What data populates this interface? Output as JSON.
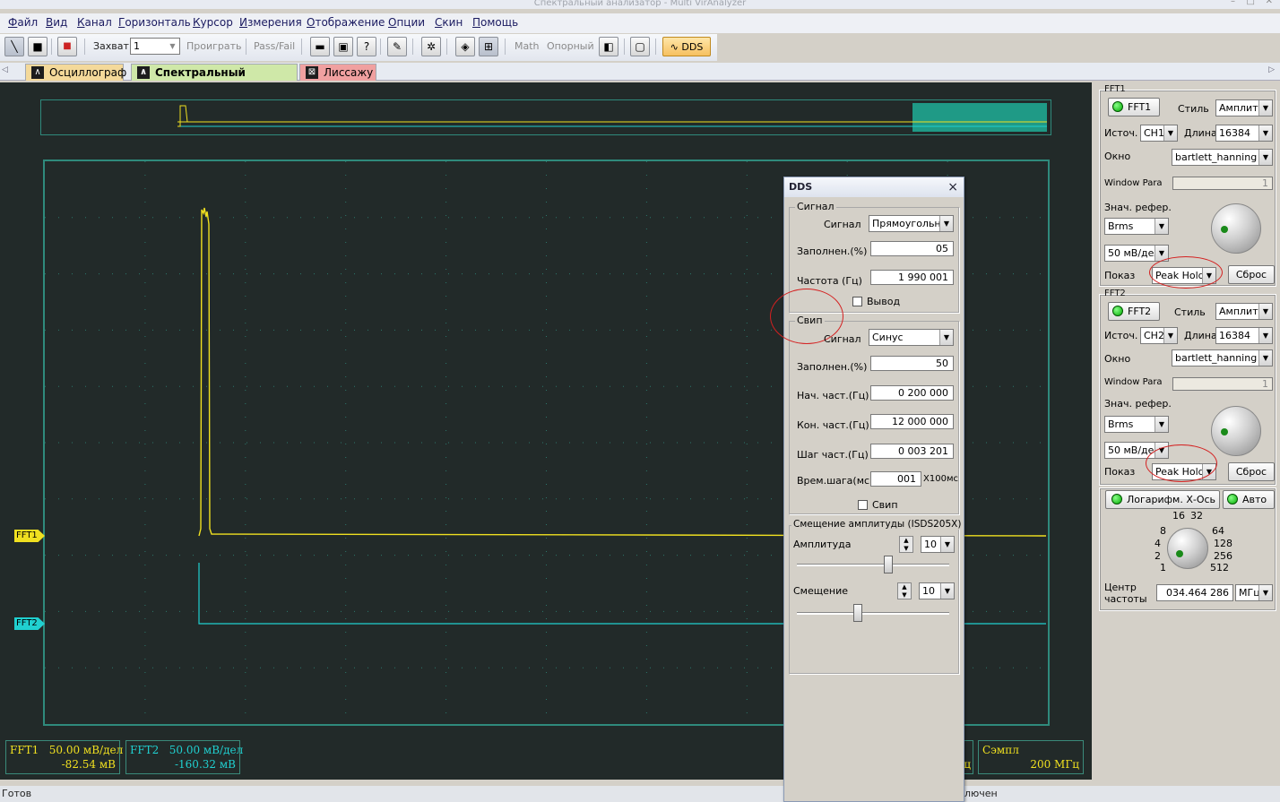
{
  "window": {
    "title": "Спектральный анализатор - Multi VirAnalyzer"
  },
  "menu": [
    "Файл",
    "Вид",
    "Канал",
    "Горизонталь",
    "Курсор",
    "Измерения",
    "Отображение",
    "Опции",
    "Скин",
    "Помощь"
  ],
  "toolbar": {
    "capture_label": "Захват",
    "capture_value": "1",
    "play_label": "Проиграть",
    "passfail_label": "Pass/Fail",
    "math_label": "Math",
    "ref_label": "Опорный",
    "dds_label": "DDS"
  },
  "tabs": [
    {
      "label": "Осциллограф",
      "color": "#f4d99a"
    },
    {
      "label": "Спектральный анализатор",
      "color": "#cfe8a8"
    },
    {
      "label": "Лиссажу",
      "color": "#f0a0a0"
    }
  ],
  "plot": {
    "fft1_marker": "FFT1",
    "fft2_marker": "FFT2",
    "colors": {
      "fft1": "#f0e020",
      "fft2": "#20d0d0",
      "grid": "#2f8a7c",
      "bg": "#222a29"
    }
  },
  "info": {
    "fft1_line1": "FFT1   50.00 мВ/дел",
    "fft1_line2": "-82.54 мВ",
    "fft2_line1": "FFT2   50.00 мВ/дел",
    "fft2_line2": "-160.32 мВ",
    "partial_unit": "ц",
    "sample_label": "Сэмпл",
    "sample_value": "200 МГц"
  },
  "status": {
    "left": "Готов",
    "right": "лючен"
  },
  "fft1_panel": {
    "title": "FFT1",
    "toggle": "FFT1",
    "style_label": "Стиль",
    "style_value": "Амплиту",
    "source_label": "Источ.",
    "source_value": "CH1",
    "length_label": "Длина",
    "length_value": "16384",
    "window_label": "Окно",
    "window_value": "bartlett_hanning",
    "window_para_label": "Window Para",
    "window_para_value": "1",
    "ref_label": "Знач. рефер.",
    "ref_value": "Brms",
    "scale_value": "50 мВ/дел",
    "show_label": "Показ",
    "show_value": "Peak Hold",
    "reset_label": "Сброс"
  },
  "fft2_panel": {
    "title": "FFT2",
    "toggle": "FFT2",
    "style_label": "Стиль",
    "style_value": "Амплиту",
    "source_label": "Источ.",
    "source_value": "CH2",
    "length_label": "Длина",
    "length_value": "16384",
    "window_label": "Окно",
    "window_value": "bartlett_hanning",
    "window_para_label": "Window Para",
    "window_para_value": "1",
    "ref_label": "Знач. рефер.",
    "ref_value": "Brms",
    "scale_value": "50 мВ/дел",
    "show_label": "Показ",
    "show_value": "Peak Hold",
    "reset_label": "Сброс"
  },
  "bottom_panel": {
    "log_x_label": "Логарифм. Х-Ось",
    "auto_label": "Авто",
    "knob_ticks": [
      "16",
      "32",
      "8",
      "64",
      "4",
      "128",
      "2",
      "256",
      "1",
      "512"
    ],
    "center_label_1": "Центр",
    "center_label_2": "частоты",
    "center_value": "034.464 286",
    "center_unit": "МГц"
  },
  "dds": {
    "title": "DDS",
    "close": "×",
    "signal_group": "Сигнал",
    "signal_label": "Сигнал",
    "signal_value": "Прямоугольны",
    "fill_label": "Заполнен.(%)",
    "fill_value": "05",
    "freq_label": "Частота (Гц)",
    "freq_value": "1 990 001",
    "output_label": "Вывод",
    "sweep_group": "Свип",
    "sweep_signal_label": "Сигнал",
    "sweep_signal_value": "Синус",
    "sweep_fill_label": "Заполнен.(%)",
    "sweep_fill_value": "50",
    "start_label": "Нач. част.(Гц)",
    "start_value": "0 200 000",
    "end_label": "Кон. част.(Гц)",
    "end_value": "12 000 000",
    "step_label": "Шаг част.(Гц)",
    "step_value": "0 003 201",
    "time_label": "Врем.шага(мс)",
    "time_value": "001",
    "time_unit": "X100мс",
    "sweep_check_label": "Свип",
    "offset_group": "Смещение амплитуды (ISDS205X)",
    "amp_label": "Амплитуда",
    "amp_value": "10",
    "amp_level": 0.6,
    "offset_label": "Смещение",
    "offset_value": "10",
    "offset_level": 0.4
  }
}
